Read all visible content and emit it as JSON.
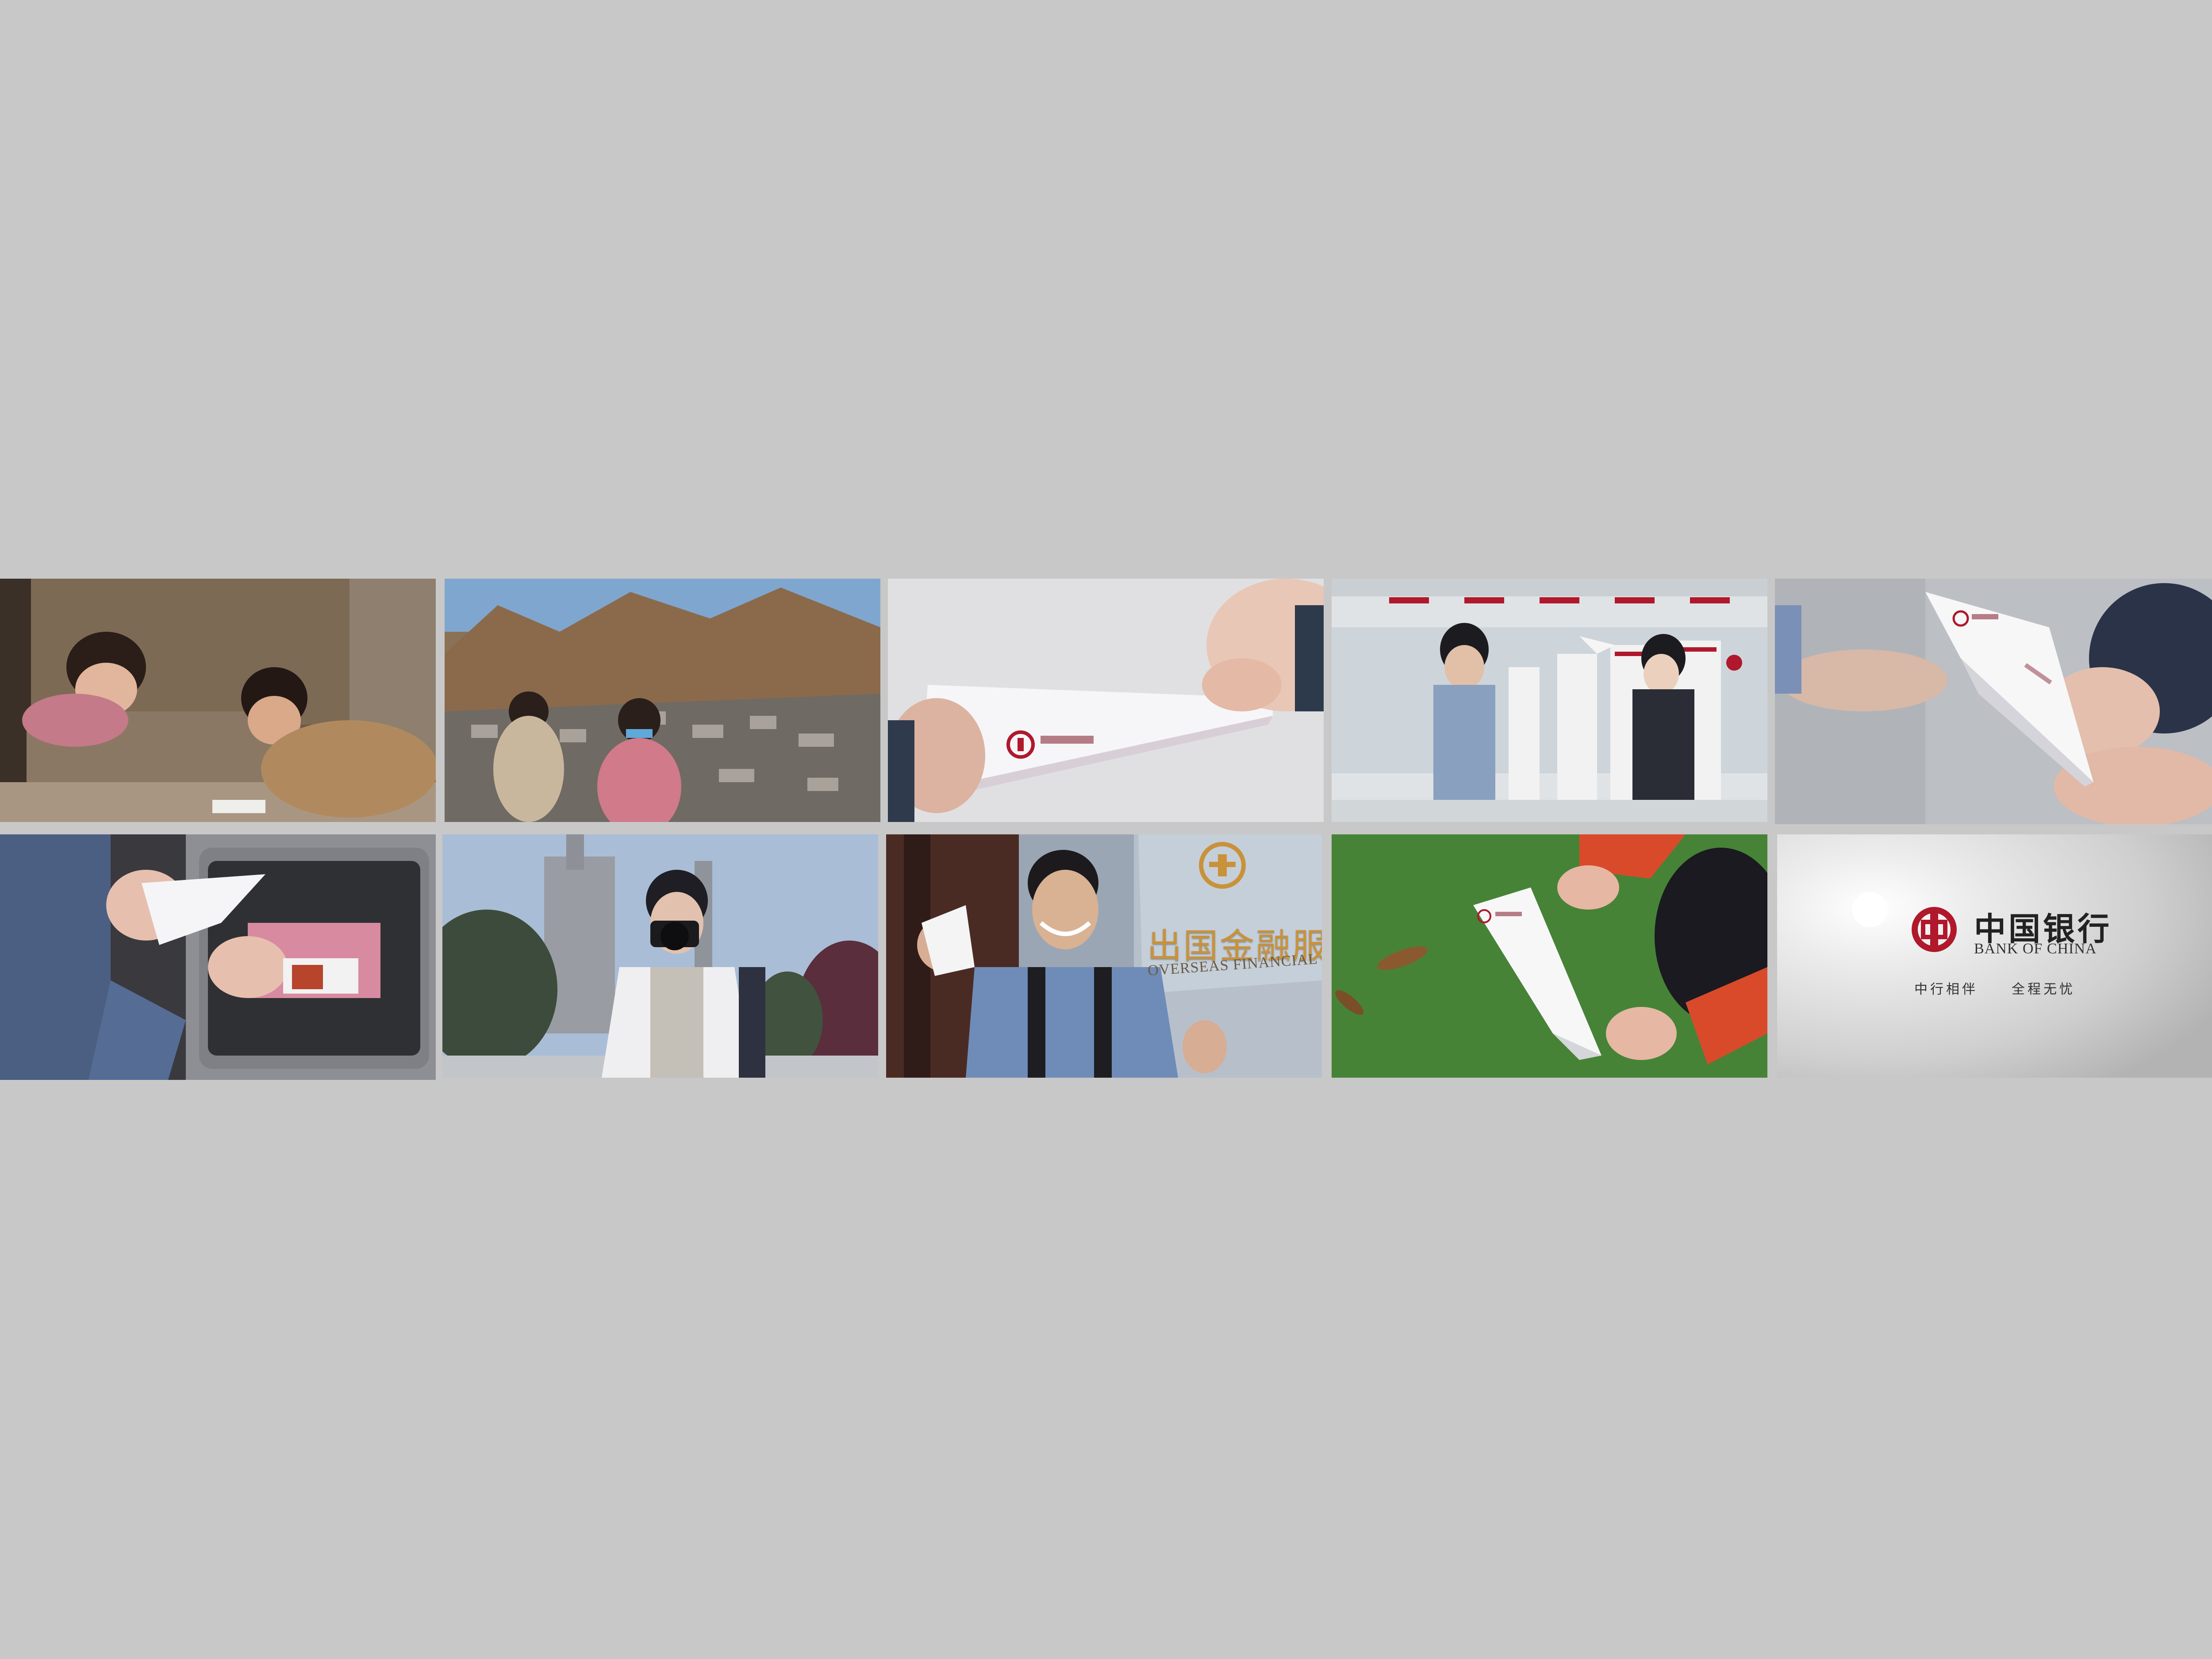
{
  "storyboard": {
    "frames": [
      {
        "scene": "children-drawing"
      },
      {
        "scene": "children-mountain-village"
      },
      {
        "scene": "folding-paper-plane"
      },
      {
        "scene": "bank-branch-counter"
      },
      {
        "scene": "passing-paper-plane"
      },
      {
        "scene": "packing-suitcase"
      },
      {
        "scene": "photographer-cathedral"
      },
      {
        "scene": "overseas-service-sign"
      },
      {
        "scene": "paper-plane-grass"
      },
      {
        "scene": "end-card-logo"
      }
    ],
    "sign": {
      "cn": "出国金融服务",
      "en": "OVERSEAS FINANCIAL SERVICE"
    },
    "end_card": {
      "name_cn": "中国银行",
      "name_en": "BANK OF CHINA",
      "slogan_left": "中行相伴",
      "slogan_right": "全程无忧"
    },
    "colors": {
      "background": "#c8c8c8",
      "brand_red": "#b0182b"
    }
  }
}
